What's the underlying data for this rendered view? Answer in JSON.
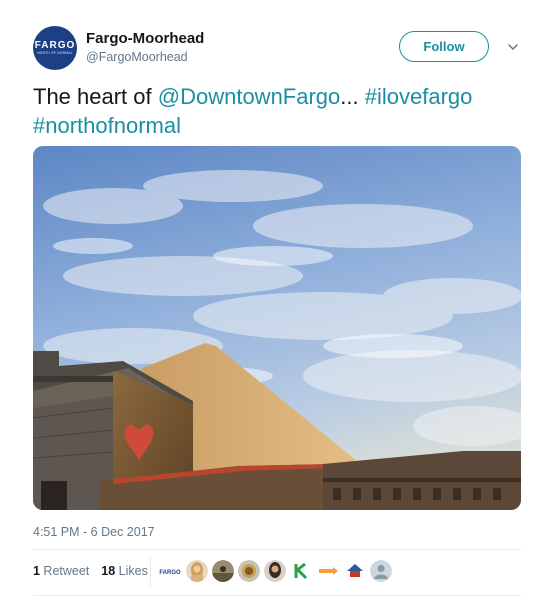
{
  "author": {
    "display_name": "Fargo-Moorhead",
    "handle": "@FargoMoorhead",
    "avatar_text": "FARGO",
    "avatar_subtext": "north of normal"
  },
  "follow_button": {
    "label": "Follow"
  },
  "tweet": {
    "text_before": "The heart of ",
    "mention": "@DowntownFargo",
    "text_middle": "... ",
    "hashtag1": "#ilovefargo",
    "hashtag2": "#northofnormal"
  },
  "photo": {
    "icon": "photo-sky-buildings-heart"
  },
  "timestamp": "4:51 PM - 6 Dec 2017",
  "stats": {
    "retweet_count": "1",
    "retweet_label": " Retweet",
    "like_count": "18",
    "like_label": " Likes"
  },
  "likers_logo_text": "FARGO",
  "colors": {
    "accent": "#1b8fa1",
    "avatar_bg": "#1d3f86",
    "secondary_text": "#657786"
  }
}
